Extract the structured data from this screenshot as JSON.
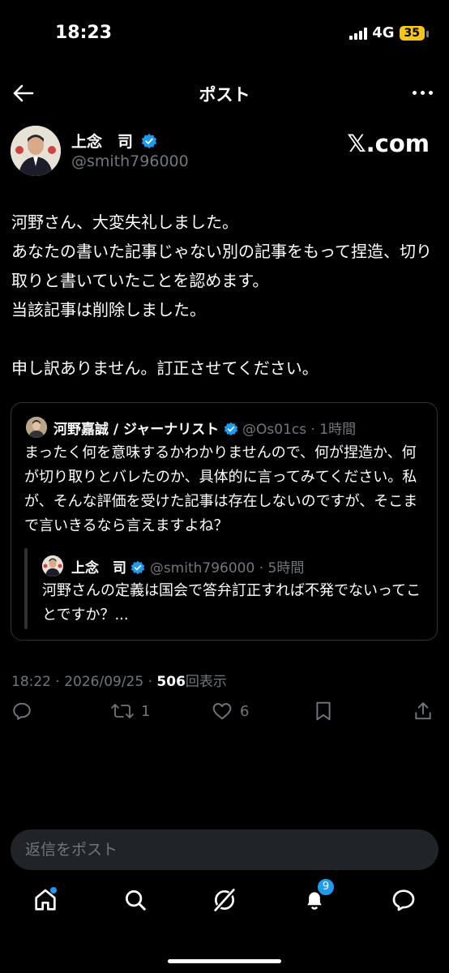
{
  "status": {
    "time": "18:23",
    "network": "4G",
    "battery": "35"
  },
  "nav": {
    "title": "ポスト"
  },
  "author": {
    "name": "上念　司",
    "handle": "@smith796000"
  },
  "brand": "𝕏.com",
  "post": {
    "text": "河野さん、大変失礼しました。\nあなたの書いた記事じゃない別の記事をもって捏造、切り取りと書いていたことを認めます。\n当該記事は削除しました。\n\n申し訳ありません。訂正させてください。"
  },
  "quote": {
    "name": "河野嘉誠 / ジャーナリスト",
    "handle": "@Os01cs",
    "time": "· 1時間",
    "text": "まったく何を意味するかわかりませんので、何が捏造か、何が切り取りとバレたのか、具体的に言ってみてください。私が、そんな評価を受けた記事は存在しないのですが、そこまで言いきるなら言えますよね？",
    "nested": {
      "name": "上念　司",
      "handle": "@smith796000",
      "time": "· 5時間",
      "text": "河野さんの定義は国会で答弁訂正すれば不発でないってことですか？..."
    }
  },
  "meta": {
    "timestamp": "18:22 · 2026/09/25 · ",
    "views_count": "506",
    "views_label": "回表示"
  },
  "actions": {
    "retweets": "1",
    "likes": "6"
  },
  "reply": {
    "placeholder": "返信をポスト"
  },
  "tabs": {
    "notifications_badge": "9"
  },
  "colors": {
    "background": "#000000",
    "accent": "#1d9bf0",
    "muted": "#71767b"
  }
}
